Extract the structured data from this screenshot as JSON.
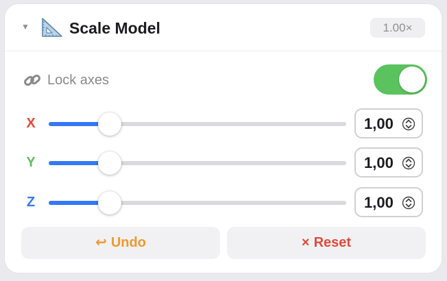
{
  "header": {
    "title": "Scale Model",
    "scale_badge": "1.00×",
    "collapse_glyph": "▼",
    "icon": "triangle-ruler-icon"
  },
  "lock": {
    "label": "Lock axes",
    "icon": "link-icon",
    "enabled": true,
    "toggle_color": "#5ac35e"
  },
  "axes": [
    {
      "label": "X",
      "color": "#e5483b",
      "value_text": "1,00",
      "value": 1.0,
      "slider_fraction": 0.205
    },
    {
      "label": "Y",
      "color": "#5cbf60",
      "value_text": "1,00",
      "value": 1.0,
      "slider_fraction": 0.205
    },
    {
      "label": "Z",
      "color": "#3478f6",
      "value_text": "1,00",
      "value": 1.0,
      "slider_fraction": 0.205
    }
  ],
  "slider_accent": "#3478f6",
  "buttons": {
    "undo_glyph": "↩",
    "undo_label": "Undo",
    "undo_color": "#f0982e",
    "reset_glyph": "×",
    "reset_label": "Reset",
    "reset_color": "#e04a3b"
  }
}
